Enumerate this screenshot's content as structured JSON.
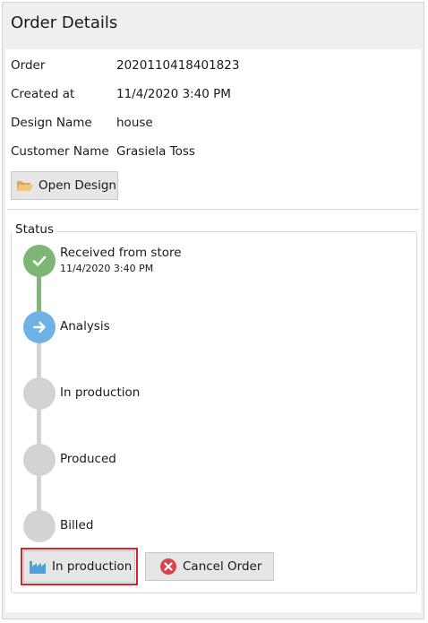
{
  "panel": {
    "title": "Order Details"
  },
  "order": {
    "fields": [
      {
        "label": "Order",
        "value": "2020110418401823"
      },
      {
        "label": "Created at",
        "value": "11/4/2020 3:40 PM"
      },
      {
        "label": "Design Name",
        "value": "house"
      },
      {
        "label": "Customer Name",
        "value": "Grasiela Toss"
      }
    ],
    "open_design_label": "Open Design",
    "open_design_icon": "folder-open-icon"
  },
  "status": {
    "group_title": "Status",
    "steps": [
      {
        "label": "Received from store",
        "timestamp": "11/4/2020 3:40 PM",
        "state": "done",
        "icon": "check-icon"
      },
      {
        "label": "Analysis",
        "state": "current",
        "icon": "arrow-right-icon"
      },
      {
        "label": "In production",
        "state": "pending"
      },
      {
        "label": "Produced",
        "state": "pending"
      },
      {
        "label": "Billed",
        "state": "pending"
      }
    ],
    "colors": {
      "done": "#7cb874",
      "current": "#6fb3e6",
      "pending": "#d3d3d3"
    }
  },
  "actions": {
    "advance_label": "In production",
    "advance_icon": "factory-icon",
    "cancel_label": "Cancel Order",
    "cancel_icon": "cancel-circle-icon",
    "highlight_color": "#d9232b"
  }
}
